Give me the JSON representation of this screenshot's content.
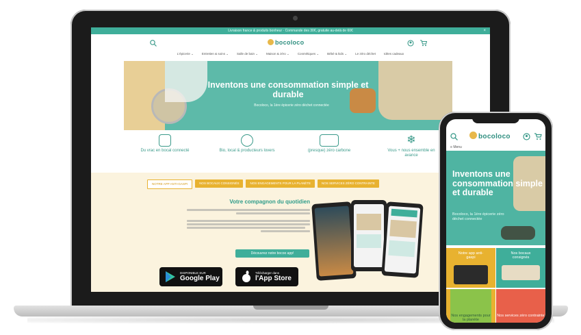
{
  "laptop_page": {
    "announcement": "Livraison france & produits bonheur · Commande des 30€, gratuite au-delà de 60€",
    "logo_text": "bocoloco",
    "nav_items": [
      "L'épicerie ⌄",
      "Entretien & soins ⌄",
      "Salle de bain ⌄",
      "Maison & zéro ⌄",
      "Cosmétiques ⌄",
      "Bébé & kids ⌄",
      "Le zéro déchet",
      "Idées cadeaux"
    ],
    "hero_title": "Inventons une consommation simple et durable",
    "hero_subtitle": "Bocoloco, la 1ère épicerie zéro déchet connectée",
    "features": [
      {
        "icon": "jar-icon",
        "label": "Du vrac en bocal connecté"
      },
      {
        "icon": "leaf-badge-icon",
        "label": "Bio, local & producteurs lovers"
      },
      {
        "icon": "bike-delivery-icon",
        "label": "(presque) zéro carbone"
      },
      {
        "icon": "snowflake-icon",
        "label": "Vous + nous ensemble en avance"
      }
    ],
    "tabs": [
      "NOTRE APP ANTI-GASPI",
      "NOS BOCAUX CONSIGNÉS",
      "NOS ENGAGEMENTS POUR LA PLANÈTE",
      "NOS SERVICES ZÉRO CONTRAINTE"
    ],
    "section_title": "Votre compagnon du quotidien",
    "discover_button": "Découvrez notre bocoo app!",
    "google_play": {
      "small": "DISPONIBLE SUR",
      "big": "Google Play"
    },
    "app_store": {
      "small": "Télécharger dans",
      "big": "l'App Store"
    }
  },
  "phone_page": {
    "logo_text": "bocoloco",
    "menu_label": "Menu",
    "hero_title": "Inventons une consommation simple et durable",
    "hero_subtitle": "Bocoloco, la 1ère épicerie zéro déchet connectée",
    "tiles": [
      {
        "label": "Notre app anti-gaspi",
        "color": "#e8b230"
      },
      {
        "label": "Nos bocaux consignés",
        "color": "#3fae9a"
      },
      {
        "label": "Nos engagements pour la planète",
        "color": "#e8b230"
      },
      {
        "label": "Nos services zéro contrainte",
        "color": "#e8604a"
      }
    ]
  },
  "colors": {
    "teal": "#3fae9a",
    "mustard": "#e8b230",
    "cream": "#fbf3de",
    "coral": "#e8604a"
  }
}
